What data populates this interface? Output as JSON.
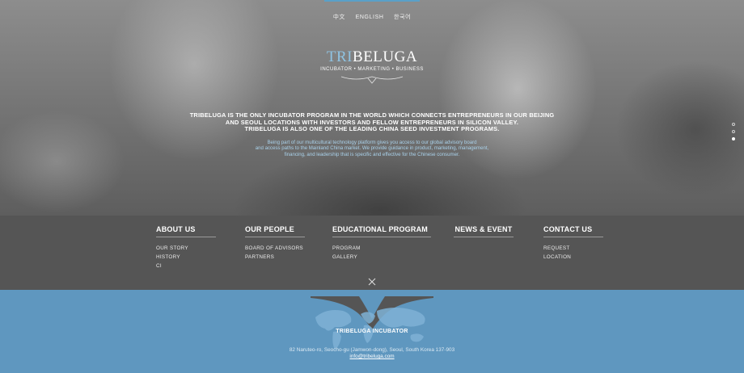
{
  "languages": [
    "中文",
    "ENGLISH",
    "한국어"
  ],
  "logo": {
    "part_a": "TRI",
    "part_b": "BELUGA",
    "tagline": "INCUBATOR • MARKETING • BUSINESS"
  },
  "intro": {
    "lines": [
      "TRIBELUGA IS THE ONLY INCUBATOR PROGRAM IN THE WORLD WHICH CONNECTS ENTREPRENEURS IN OUR BEIJING",
      "AND SEOUL LOCATIONS WITH INVESTORS AND FELLOW ENTREPRENEURS IN SILICON VALLEY.",
      "TRIBELUGA IS ALSO ONE OF THE LEADING CHINA SEED INVESTMENT PROGRAMS."
    ],
    "description": [
      "Being part of our multicultural technology platform gives you access to our global advisory board",
      "and access paths to the Mainland China market. We provide guidance in product, marketing, management,",
      "financing, and leadership that is specific and effective for the Chinese consumer."
    ]
  },
  "slider": {
    "count": 3,
    "active_index": 2
  },
  "nav": [
    {
      "title": "ABOUT US",
      "items": [
        "OUR STORY",
        "HISTORY",
        "CI"
      ]
    },
    {
      "title": "OUR PEOPLE",
      "items": [
        "BOARD OF ADVISORS",
        "PARTNERS"
      ]
    },
    {
      "title": "EDUCATIONAL PROGRAM",
      "items": [
        "PROGRAM",
        "GALLERY"
      ]
    },
    {
      "title": "NEWS & EVENT",
      "items": []
    },
    {
      "title": "CONTACT US",
      "items": [
        "REQUEST",
        "LOCATION"
      ]
    }
  ],
  "footer": {
    "name": "TRIBELUGA INCUBATOR",
    "address": "82 Naruteo-ro, Seocho-gu (Jamwon-dong), Seoul, South Korea 137-903",
    "email": "info@tribeluga.com"
  },
  "colors": {
    "accent": "#5aa0c8",
    "footer_bg": "#5f97bf",
    "nav_bg": "#555555"
  },
  "icons": {
    "close": "close-icon",
    "logo_swoosh": "swoosh-icon",
    "footer_map": "world-map-icon"
  }
}
